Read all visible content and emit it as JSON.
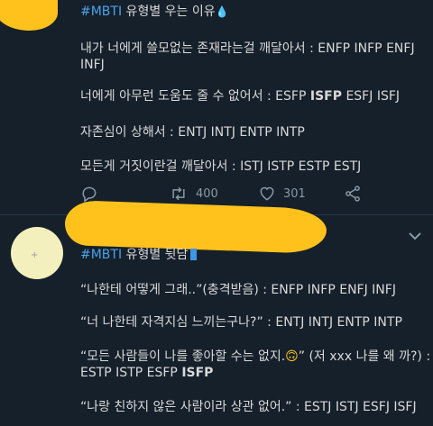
{
  "tweet1": {
    "hashtag": "#MBTI",
    "title": " 유형별 우는 이유",
    "drop_emoji": "💧",
    "line1a": "내가 너에게 쓸모없는 존재라는걸 깨달아서 : ENFP INFP ENFJ",
    "line1b": "INFJ",
    "line2_pre": "너에게 아무런 도움도 줄 수 없어서 : ESFP ",
    "line2_bold": "ISFP",
    "line2_post": " ESFJ ISFJ",
    "line3": "자존심이 상해서 : ENTJ INTJ ENTP INTP",
    "line4": "모든게 거짓이란걸 깨달아서 : ISTJ ISTP ESTP ESTJ",
    "actions": {
      "retweets": "400",
      "likes": "301"
    }
  },
  "tweet2": {
    "hashtag": "#MBTI",
    "title": " 유형별 뒷담",
    "line1": "“나한테 어떻게 그래..”(충격받음) : ENFP INFP ENFJ INFJ",
    "line2": "“너 나한테 자격지심 느끼는구나?” : ENTJ INTJ ENTP INTP",
    "line3a_pre": "“모든 사람들이 나를 좋아할 수는 없지.",
    "line3a_emoji": "🙃",
    "line3a_post": "” (저 xxx 나를 왜 까?) :",
    "line3b_pre": "ESTP ISTP ESFP ",
    "line3b_bold": "ISFP",
    "line4": "“나랑 친하지 않은 사람이라 상관 없어.” : ESTJ ISTJ ESFJ ISFJ"
  },
  "colors": {
    "background": "#15202b",
    "accent": "#4aa3e8",
    "highlight": "#ffc21c",
    "muted": "#8899a6"
  },
  "icons": [
    "reply-icon",
    "retweet-icon",
    "like-icon",
    "share-icon",
    "chevron-down-icon"
  ]
}
